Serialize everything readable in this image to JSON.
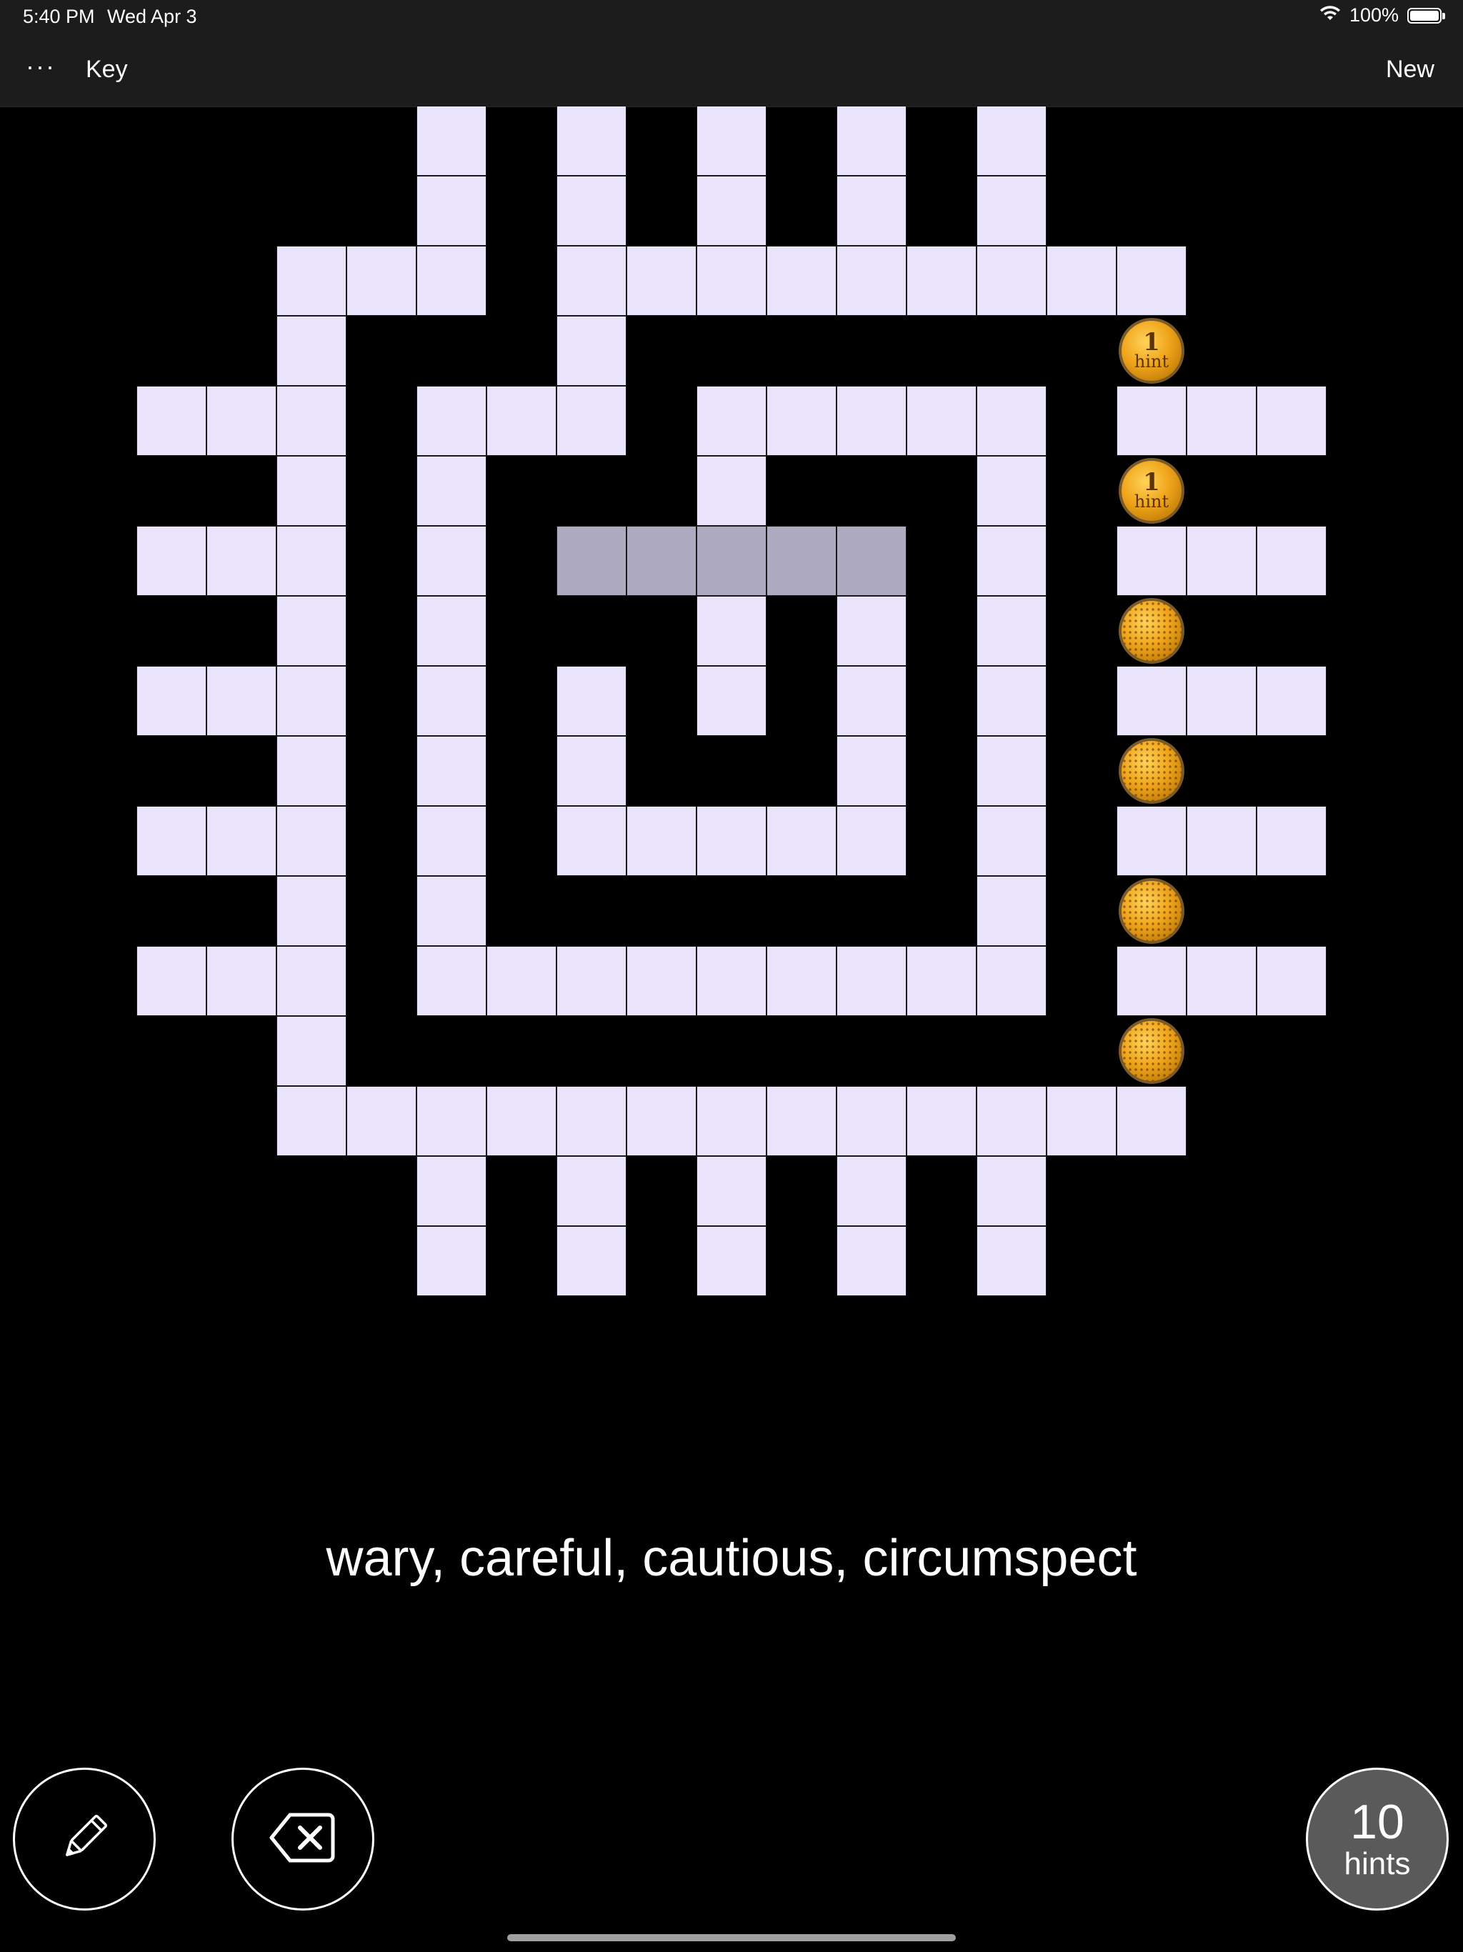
{
  "status_bar": {
    "time": "5:40 PM",
    "date": "Wed Apr 3",
    "battery": "100%"
  },
  "toolbar": {
    "more_label": "···",
    "key_label": "Key",
    "new_label": "New"
  },
  "board": {
    "columns": 17,
    "rows": 17,
    "cells": [
      [
        0,
        5
      ],
      [
        0,
        7
      ],
      [
        0,
        9
      ],
      [
        0,
        11
      ],
      [
        0,
        13
      ],
      [
        1,
        5
      ],
      [
        1,
        7
      ],
      [
        1,
        9
      ],
      [
        1,
        11
      ],
      [
        1,
        13
      ],
      [
        2,
        3
      ],
      [
        2,
        4
      ],
      [
        2,
        5
      ],
      [
        2,
        7
      ],
      [
        2,
        8
      ],
      [
        2,
        9
      ],
      [
        2,
        10
      ],
      [
        2,
        11
      ],
      [
        2,
        12
      ],
      [
        2,
        13
      ],
      [
        2,
        14
      ],
      [
        2,
        15
      ],
      [
        3,
        3
      ],
      [
        3,
        7
      ],
      [
        3,
        15
      ],
      [
        4,
        1
      ],
      [
        4,
        2
      ],
      [
        4,
        3
      ],
      [
        4,
        5
      ],
      [
        4,
        6
      ],
      [
        4,
        7
      ],
      [
        4,
        9
      ],
      [
        4,
        10
      ],
      [
        4,
        11
      ],
      [
        4,
        12
      ],
      [
        4,
        13
      ],
      [
        4,
        15
      ],
      [
        4,
        16
      ],
      [
        4,
        17
      ],
      [
        5,
        3
      ],
      [
        5,
        5
      ],
      [
        5,
        9
      ],
      [
        5,
        13
      ],
      [
        5,
        15
      ],
      [
        6,
        1
      ],
      [
        6,
        2
      ],
      [
        6,
        3
      ],
      [
        6,
        5
      ],
      [
        6,
        7
      ],
      [
        6,
        8
      ],
      [
        6,
        9
      ],
      [
        6,
        10
      ],
      [
        6,
        11
      ],
      [
        6,
        13
      ],
      [
        6,
        15
      ],
      [
        6,
        16
      ],
      [
        6,
        17
      ],
      [
        7,
        3
      ],
      [
        7,
        5
      ],
      [
        7,
        9
      ],
      [
        7,
        11
      ],
      [
        7,
        13
      ],
      [
        7,
        15
      ],
      [
        8,
        1
      ],
      [
        8,
        2
      ],
      [
        8,
        3
      ],
      [
        8,
        5
      ],
      [
        8,
        7
      ],
      [
        8,
        9
      ],
      [
        8,
        11
      ],
      [
        8,
        13
      ],
      [
        8,
        15
      ],
      [
        8,
        16
      ],
      [
        8,
        17
      ],
      [
        9,
        3
      ],
      [
        9,
        5
      ],
      [
        9,
        7
      ],
      [
        9,
        11
      ],
      [
        9,
        13
      ],
      [
        9,
        15
      ],
      [
        10,
        1
      ],
      [
        10,
        2
      ],
      [
        10,
        3
      ],
      [
        10,
        5
      ],
      [
        10,
        7
      ],
      [
        10,
        8
      ],
      [
        10,
        9
      ],
      [
        10,
        10
      ],
      [
        10,
        11
      ],
      [
        10,
        13
      ],
      [
        10,
        15
      ],
      [
        10,
        16
      ],
      [
        10,
        17
      ],
      [
        11,
        3
      ],
      [
        11,
        5
      ],
      [
        11,
        13
      ],
      [
        11,
        15
      ],
      [
        12,
        1
      ],
      [
        12,
        2
      ],
      [
        12,
        3
      ],
      [
        12,
        5
      ],
      [
        12,
        6
      ],
      [
        12,
        7
      ],
      [
        12,
        8
      ],
      [
        12,
        9
      ],
      [
        12,
        10
      ],
      [
        12,
        11
      ],
      [
        12,
        12
      ],
      [
        12,
        13
      ],
      [
        12,
        15
      ],
      [
        12,
        16
      ],
      [
        12,
        17
      ],
      [
        13,
        3
      ],
      [
        13,
        15
      ],
      [
        14,
        3
      ],
      [
        14,
        4
      ],
      [
        14,
        5
      ],
      [
        14,
        6
      ],
      [
        14,
        7
      ],
      [
        14,
        8
      ],
      [
        14,
        9
      ],
      [
        14,
        10
      ],
      [
        14,
        11
      ],
      [
        14,
        12
      ],
      [
        14,
        13
      ],
      [
        14,
        14
      ],
      [
        14,
        15
      ],
      [
        15,
        5
      ],
      [
        15,
        7
      ],
      [
        15,
        9
      ],
      [
        15,
        11
      ],
      [
        15,
        13
      ],
      [
        16,
        5
      ],
      [
        16,
        7
      ],
      [
        16,
        9
      ],
      [
        16,
        11
      ],
      [
        16,
        13
      ]
    ],
    "highlighted_cells": [
      [
        6,
        7
      ],
      [
        6,
        8
      ],
      [
        6,
        9
      ],
      [
        6,
        10
      ],
      [
        6,
        11
      ]
    ],
    "hint_coins": [
      {
        "row": 3,
        "col": 15,
        "number": "1",
        "word": "hint"
      },
      {
        "row": 5,
        "col": 15,
        "number": "1",
        "word": "hint"
      },
      {
        "row": 7,
        "col": 15,
        "number": "",
        "word": ""
      },
      {
        "row": 9,
        "col": 15,
        "number": "",
        "word": ""
      },
      {
        "row": 11,
        "col": 15,
        "number": "",
        "word": ""
      },
      {
        "row": 13,
        "col": 15,
        "number": "",
        "word": ""
      }
    ],
    "cell_color": "#e9e4fb",
    "highlight_color": "#aeaac0"
  },
  "clue": {
    "text": "wary, careful, cautious, circumspect"
  },
  "controls": {
    "pencil_icon": "pencil-icon",
    "delete_icon": "backspace-icon",
    "hints_count": "10",
    "hints_label": "hints"
  }
}
